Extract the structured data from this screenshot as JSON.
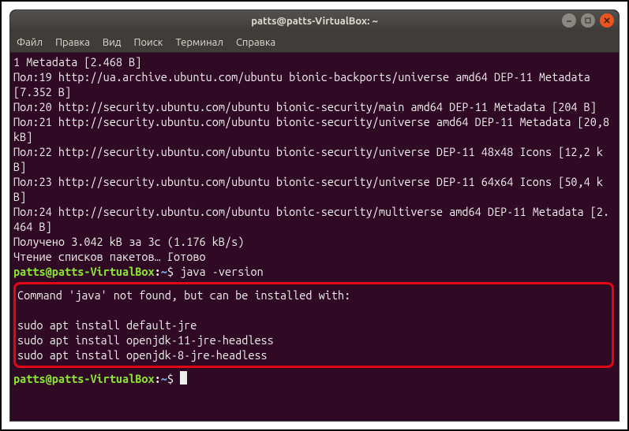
{
  "window": {
    "title": "patts@patts-VirtualBox: ~"
  },
  "menu": {
    "file": "Файл",
    "edit": "Правка",
    "view": "Вид",
    "search": "Поиск",
    "terminal": "Терминал",
    "help": "Справка"
  },
  "terminal": {
    "lines": [
      "1 Metadata [2.468 B]",
      "Пол:19 http://ua.archive.ubuntu.com/ubuntu bionic-backports/universe amd64 DEP-11 Metadata [7.352 B]",
      "Пол:20 http://security.ubuntu.com/ubuntu bionic-security/main amd64 DEP-11 Metadata [204 B]",
      "Пол:21 http://security.ubuntu.com/ubuntu bionic-security/universe amd64 DEP-11 Metadata [20,8 kB]",
      "Пол:22 http://security.ubuntu.com/ubuntu bionic-security/universe DEP-11 48x48 Icons [12,2 kB]",
      "Пол:23 http://security.ubuntu.com/ubuntu bionic-security/universe DEP-11 64x64 Icons [50,4 kB]",
      "Пол:24 http://security.ubuntu.com/ubuntu bionic-security/multiverse amd64 DEP-11 Metadata [2.464 B]",
      "Получено 3.042 kB за 3с (1.176 kB/s)",
      "Чтение списков пакетов… Готово"
    ],
    "prompt": {
      "user_host": "patts@patts-VirtualBox",
      "colon": ":",
      "path": "~",
      "dollar": "$"
    },
    "command1": "java -version",
    "highlighted": [
      "Command 'java' not found, but can be installed with:",
      "",
      "sudo apt install default-jre",
      "sudo apt install openjdk-11-jre-headless",
      "sudo apt install openjdk-8-jre-headless"
    ]
  }
}
